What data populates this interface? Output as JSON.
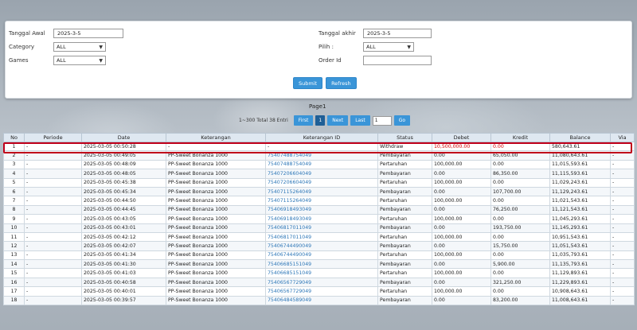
{
  "filters": {
    "tanggal_awal_label": "Tanggal Awal",
    "tanggal_awal_value": "2025-3-5",
    "tanggal_akhir_label": "Tanggal akhir",
    "tanggal_akhir_value": "2025-3-5",
    "category_label": "Category",
    "category_value": "ALL",
    "pilih_label": "Pilih :",
    "pilih_value": "ALL",
    "games_label": "Games",
    "games_value": "ALL",
    "order_id_label": "Order Id",
    "order_id_value": ""
  },
  "buttons": {
    "submit": "Submit",
    "refresh": "Refresh"
  },
  "pager": {
    "title": "Page1",
    "info": "1~300 Total 38 Entri",
    "first": "First",
    "current": "1",
    "next": "Next",
    "last": "Last",
    "page_input": "1",
    "go": "Go"
  },
  "table": {
    "headers": [
      "No",
      "Periode",
      "Date",
      "Keterangan",
      "Keterangan ID",
      "Status",
      "Debet",
      "Kredit",
      "Balance",
      "Via"
    ],
    "rows": [
      [
        "1",
        "-",
        "2025-03-05 00:50:28",
        "-",
        "-",
        "Withdraw",
        "10,500,000.00",
        "0.00",
        "580,643.61",
        "-"
      ],
      [
        "2",
        "-",
        "2025-03-05 00:49:05",
        "PP-Sweet Bonanza 1000",
        "754074887540​49",
        "Pembayaran",
        "0.00",
        "65,050.00",
        "11,080,643.61",
        "-"
      ],
      [
        "3",
        "-",
        "2025-03-05 00:48:09",
        "PP-Sweet Bonanza 1000",
        "75407488754049",
        "Pertaruhan",
        "100,000.00",
        "0.00",
        "11,015,593.61",
        "-"
      ],
      [
        "4",
        "-",
        "2025-03-05 00:48:05",
        "PP-Sweet Bonanza 1000",
        "75407206604049",
        "Pembayaran",
        "0.00",
        "86,350.00",
        "11,115,593.61",
        "-"
      ],
      [
        "5",
        "-",
        "2025-03-05 00:45:38",
        "PP-Sweet Bonanza 1000",
        "75407206604049",
        "Pertaruhan",
        "100,000.00",
        "0.00",
        "11,029,243.61",
        "-"
      ],
      [
        "6",
        "-",
        "2025-03-05 00:45:34",
        "PP-Sweet Bonanza 1000",
        "75407115264049",
        "Pembayaran",
        "0.00",
        "107,700.00",
        "11,129,243.61",
        "-"
      ],
      [
        "7",
        "-",
        "2025-03-05 00:44:50",
        "PP-Sweet Bonanza 1000",
        "75407115264049",
        "Pertaruhan",
        "100,000.00",
        "0.00",
        "11,021,543.61",
        "-"
      ],
      [
        "8",
        "-",
        "2025-03-05 00:44:45",
        "PP-Sweet Bonanza 1000",
        "75406918493049",
        "Pembayaran",
        "0.00",
        "76,250.00",
        "11,121,543.61",
        "-"
      ],
      [
        "9",
        "-",
        "2025-03-05 00:43:05",
        "PP-Sweet Bonanza 1000",
        "75406918493049",
        "Pertaruhan",
        "100,000.00",
        "0.00",
        "11,045,293.61",
        "-"
      ],
      [
        "10",
        "-",
        "2025-03-05 00:43:01",
        "PP-Sweet Bonanza 1000",
        "75406817011049",
        "Pembayaran",
        "0.00",
        "193,750.00",
        "11,145,293.61",
        "-"
      ],
      [
        "11",
        "-",
        "2025-03-05 00:42:12",
        "PP-Sweet Bonanza 1000",
        "75406817011049",
        "Pertaruhan",
        "100,000.00",
        "0.00",
        "10,951,543.61",
        "-"
      ],
      [
        "12",
        "-",
        "2025-03-05 00:42:07",
        "PP-Sweet Bonanza 1000",
        "75406744490049",
        "Pembayaran",
        "0.00",
        "15,750.00",
        "11,051,543.61",
        "-"
      ],
      [
        "13",
        "-",
        "2025-03-05 00:41:34",
        "PP-Sweet Bonanza 1000",
        "75406744490049",
        "Pertaruhan",
        "100,000.00",
        "0.00",
        "11,035,793.61",
        "-"
      ],
      [
        "14",
        "-",
        "2025-03-05 00:41:30",
        "PP-Sweet Bonanza 1000",
        "75406685151049",
        "Pembayaran",
        "0.00",
        "5,900.00",
        "11,135,793.61",
        "-"
      ],
      [
        "15",
        "-",
        "2025-03-05 00:41:03",
        "PP-Sweet Bonanza 1000",
        "75406685151049",
        "Pertaruhan",
        "100,000.00",
        "0.00",
        "11,129,893.61",
        "-"
      ],
      [
        "16",
        "-",
        "2025-03-05 00:40:58",
        "PP-Sweet Bonanza 1000",
        "75406567729049",
        "Pembayaran",
        "0.00",
        "321,250.00",
        "11,229,893.61",
        "-"
      ],
      [
        "17",
        "-",
        "2025-03-05 00:40:01",
        "PP-Sweet Bonanza 1000",
        "75406567729049",
        "Pertaruhan",
        "100,000.00",
        "0.00",
        "10,908,643.61",
        "-"
      ],
      [
        "18",
        "-",
        "2025-03-05 00:39:57",
        "PP-Sweet Bonanza 1000",
        "75406484589049",
        "Pembayaran",
        "0.00",
        "83,200.00",
        "11,008,643.61",
        "-"
      ]
    ]
  }
}
